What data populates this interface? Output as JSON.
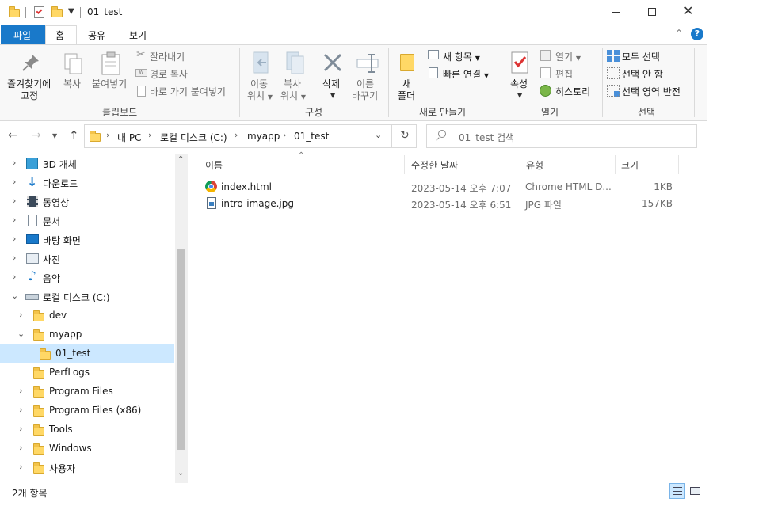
{
  "window": {
    "title": "01_test",
    "minimize_glyph": "—",
    "maximize_glyph": "□",
    "close_glyph": "✕"
  },
  "ribbon_tabs": [
    {
      "label": "파일",
      "active_blue": true
    },
    {
      "label": "홈",
      "selected": true
    },
    {
      "label": "공유"
    },
    {
      "label": "보기"
    }
  ],
  "ribbon": {
    "clipboard": {
      "pin_label_1": "즐겨찾기에",
      "pin_label_2": "고정",
      "copy_label": "복사",
      "paste_label": "붙여넣기",
      "cut_label": "잘라내기",
      "copy_path_label": "경로 복사",
      "paste_shortcut_label": "바로 가기 붙여넣기",
      "group_label": "클립보드"
    },
    "organize": {
      "move_label_1": "이동",
      "move_label_2": "위치",
      "copyto_label_1": "복사",
      "copyto_label_2": "위치",
      "delete_label": "삭제",
      "rename_label_1": "이름",
      "rename_label_2": "바꾸기",
      "group_label": "구성"
    },
    "new": {
      "new_folder_label_1": "새",
      "new_folder_label_2": "폴더",
      "new_item_label": "새 항목",
      "easy_access_label": "빠른 연결",
      "group_label": "새로 만들기"
    },
    "open": {
      "properties_label": "속성",
      "open_label": "열기",
      "edit_label": "편집",
      "history_label": "히스토리",
      "group_label": "열기"
    },
    "select": {
      "select_all_label": "모두 선택",
      "select_none_label": "선택 안 함",
      "invert_label": "선택 영역 반전",
      "group_label": "선택"
    }
  },
  "address": {
    "crumbs": [
      "내 PC",
      "로컬 디스크 (C:)",
      "myapp",
      "01_test"
    ],
    "search_placeholder": "01_test 검색"
  },
  "tree": [
    {
      "label": "3D 개체",
      "icon": "3d-objects-icon",
      "expand": "collapsed"
    },
    {
      "label": "다운로드",
      "icon": "download-icon",
      "expand": "collapsed"
    },
    {
      "label": "동영상",
      "icon": "video-icon",
      "expand": "collapsed"
    },
    {
      "label": "문서",
      "icon": "document-icon",
      "expand": "collapsed"
    },
    {
      "label": "바탕 화면",
      "icon": "desktop-icon",
      "expand": "collapsed"
    },
    {
      "label": "사진",
      "icon": "pictures-icon",
      "expand": "collapsed"
    },
    {
      "label": "음악",
      "icon": "music-icon",
      "expand": "collapsed"
    },
    {
      "label": "로컬 디스크 (C:)",
      "icon": "drive-icon",
      "expand": "expanded"
    },
    {
      "label": "dev",
      "icon": "folder-icon",
      "expand": "collapsed"
    },
    {
      "label": "myapp",
      "icon": "folder-icon",
      "expand": "expanded"
    },
    {
      "label": "01_test",
      "icon": "folder-icon",
      "expand": "none",
      "selected": true
    },
    {
      "label": "PerfLogs",
      "icon": "folder-icon",
      "expand": "none"
    },
    {
      "label": "Program Files",
      "icon": "folder-icon",
      "expand": "collapsed"
    },
    {
      "label": "Program Files (x86)",
      "icon": "folder-icon",
      "expand": "collapsed"
    },
    {
      "label": "Tools",
      "icon": "folder-icon",
      "expand": "collapsed"
    },
    {
      "label": "Windows",
      "icon": "folder-icon",
      "expand": "collapsed"
    },
    {
      "label": "사용자",
      "icon": "folder-icon",
      "expand": "collapsed"
    }
  ],
  "columns": {
    "name": "이름",
    "modified": "수정한 날짜",
    "type": "유형",
    "size": "크기"
  },
  "files": [
    {
      "name": "index.html",
      "icon": "chrome-icon",
      "modified": "2023-05-14 오후 7:07",
      "type": "Chrome HTML D...",
      "size": "1KB"
    },
    {
      "name": "intro-image.jpg",
      "icon": "image-file-icon",
      "modified": "2023-05-14 오후 6:51",
      "type": "JPG 파일",
      "size": "157KB"
    }
  ],
  "status": {
    "item_count": "2개 항목"
  },
  "colors": {
    "accent": "#1979ca",
    "selected_bg": "#cce8ff",
    "folder_yellow": "#ffd866"
  }
}
